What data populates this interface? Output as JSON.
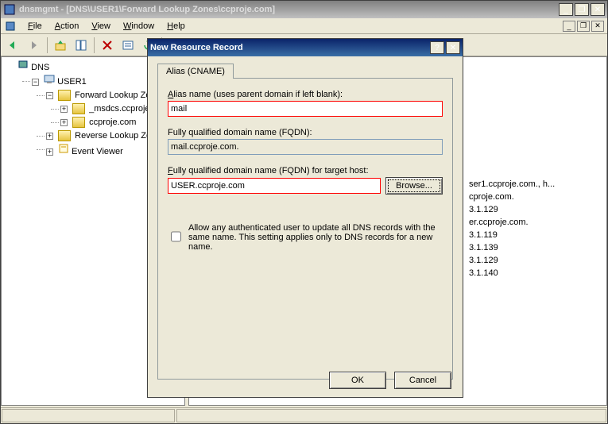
{
  "main_window": {
    "title": "dnsmgmt - [DNS\\USER1\\Forward Lookup Zones\\ccproje.com]"
  },
  "menu": {
    "file": "File",
    "action": "Action",
    "view": "View",
    "window": "Window",
    "help": "Help"
  },
  "tree": {
    "root": "DNS",
    "server": "USER1",
    "fwd": "Forward Lookup Zones",
    "zone1": "_msdcs.ccproje.com",
    "zone2": "ccproje.com",
    "rev": "Reverse Lookup Zones",
    "ev": "Event Viewer"
  },
  "records": [
    "ser1.ccproje.com., h...",
    "cproje.com.",
    "3.1.129",
    "er.ccproje.com.",
    "3.1.119",
    "3.1.139",
    "3.1.129",
    "3.1.140"
  ],
  "dialog": {
    "title": "New Resource Record",
    "tab": "Alias (CNAME)",
    "alias_label": "Alias name (uses parent domain if left blank):",
    "alias_value": "mail",
    "fqdn_label": "Fully qualified domain name (FQDN):",
    "fqdn_value": "mail.ccproje.com.",
    "target_label": "Fully qualified domain name (FQDN) for target host:",
    "target_value": "USER.ccproje.com",
    "browse": "Browse...",
    "check_label": "Allow any authenticated user to update all DNS records with the same name. This setting applies only to DNS records for a new name.",
    "ok": "OK",
    "cancel": "Cancel"
  }
}
